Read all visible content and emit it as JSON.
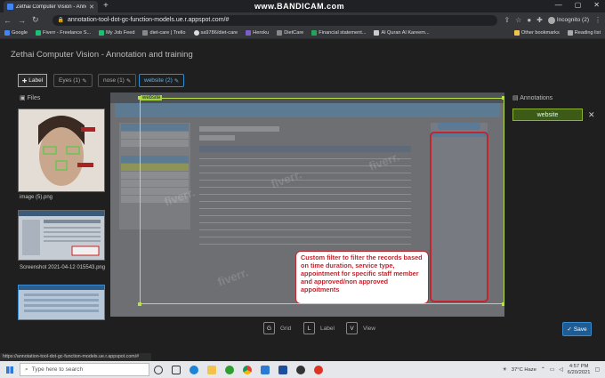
{
  "browser": {
    "tab_title": "Zethai Computer Vision - Annotation",
    "recorder_watermark": "www.BANDICAM.com",
    "url": "annotation-tool-dot-gc-function-models.ue.r.appspot.com/#",
    "profile": "Incognito (2)"
  },
  "bookmarks": {
    "left": [
      "Google",
      "Fiverr - Freelance S...",
      "My Job Feed",
      "diet-care | Trello",
      "sa9786/diet-care",
      "Heroku",
      "DietCare",
      "Financial statement...",
      "Al Quran Al Kareem..."
    ],
    "right": [
      "Other bookmarks",
      "Reading list"
    ]
  },
  "app": {
    "title": "Zethai Computer Vision - Annotation and training",
    "label_button": "Label",
    "class_pills": [
      "Eyes (1)",
      "nose (1)",
      "website (2)"
    ],
    "files_heading": "Files",
    "files": [
      {
        "name": "image (5).png"
      },
      {
        "name": "Screenshot 2021-04-12 015543.png"
      },
      {
        "name": ""
      }
    ],
    "annotations_heading": "Annotations",
    "annotation_items": [
      "website"
    ],
    "region_label": "website",
    "note_text": "Custom filter to filter the records based on time duration, service type, appointment for specific staff member and approved/non approved appoitments",
    "controls": [
      {
        "key": "G",
        "label": "Grid"
      },
      {
        "key": "L",
        "label": "Label"
      },
      {
        "key": "V",
        "label": "View"
      }
    ],
    "save_label": "Save"
  },
  "status_url": "https://annotation-tool-dot-gc-function-models.ue.r.appspot.com/#",
  "taskbar": {
    "search_placeholder": "Type here to search",
    "weather": "37°C Haze",
    "time": "4:57 PM",
    "date": "6/20/2021"
  },
  "colors": {
    "accent": "#1f5c93",
    "region": "#b7e04b",
    "note": "#c0262e"
  }
}
